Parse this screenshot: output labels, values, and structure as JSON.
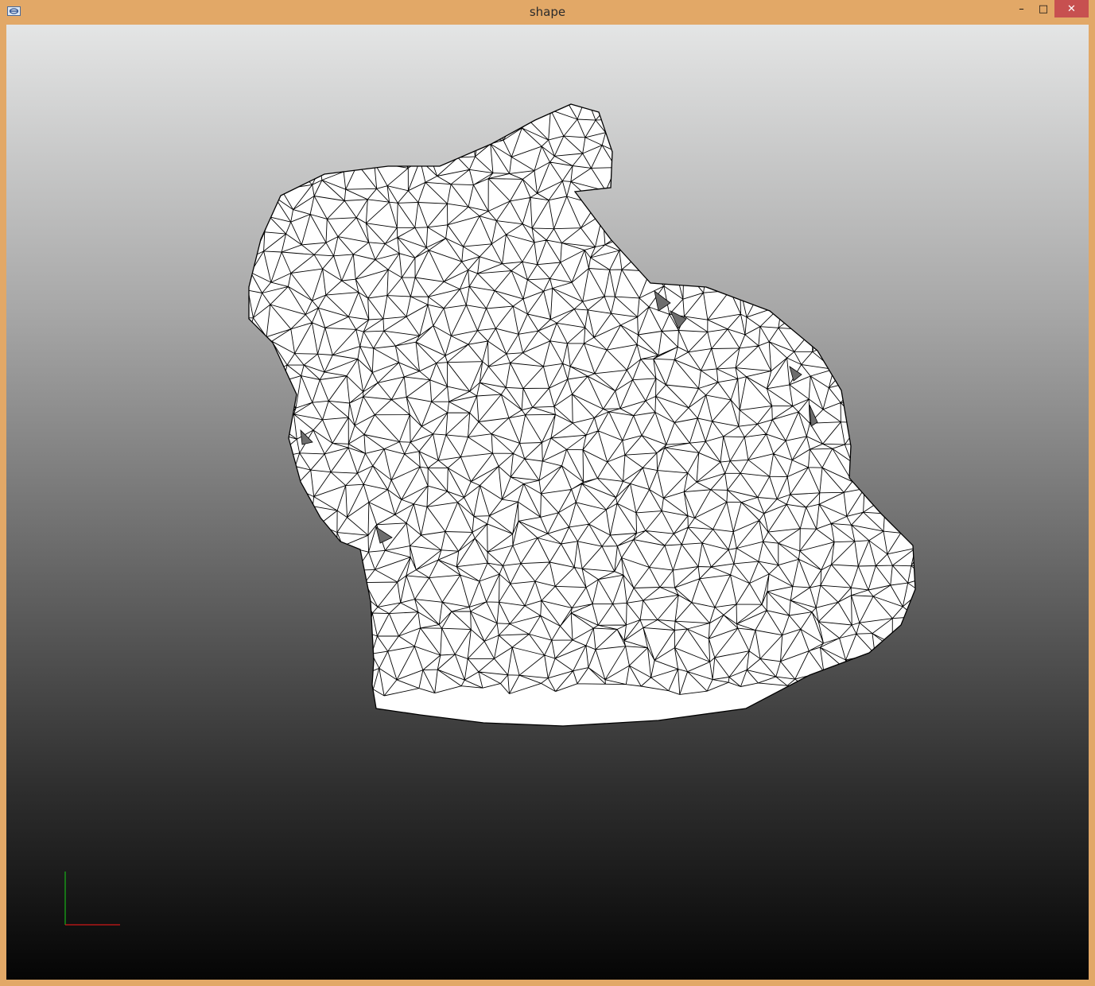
{
  "window": {
    "title": "shape",
    "controls": {
      "minimize": "–",
      "maximize": "□",
      "close": "✕"
    }
  },
  "viewport": {
    "background_top": "#e4e5e5",
    "background_bottom": "#050505",
    "mesh_fill": "#ffffff",
    "mesh_edge_color": "#000000",
    "axis_colors": {
      "x": "#d01818",
      "y": "#18b018"
    }
  }
}
